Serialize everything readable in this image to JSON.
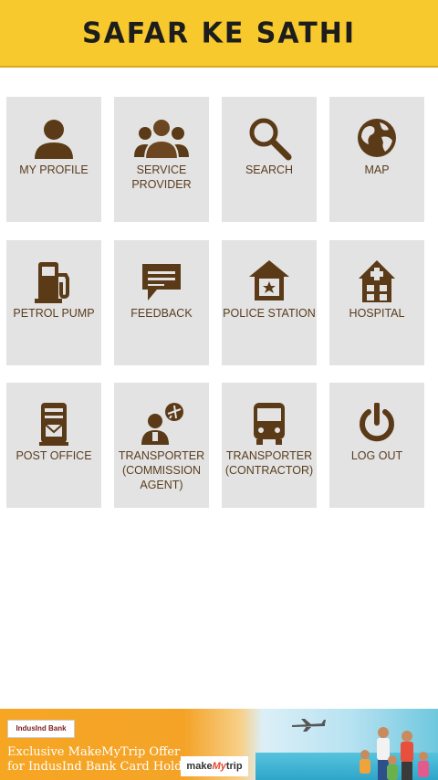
{
  "header": {
    "title": "SAFAR KE SATHI"
  },
  "tiles": [
    {
      "label": "MY PROFILE",
      "icon": "person-icon"
    },
    {
      "label": "SERVICE PROVIDER",
      "icon": "group-icon"
    },
    {
      "label": "SEARCH",
      "icon": "search-icon"
    },
    {
      "label": "MAP",
      "icon": "globe-icon"
    },
    {
      "label": "PETROL PUMP",
      "icon": "fuel-pump-icon"
    },
    {
      "label": "FEEDBACK",
      "icon": "chat-bubble-icon"
    },
    {
      "label": "POLICE STATION",
      "icon": "police-station-icon"
    },
    {
      "label": "HOSPITAL",
      "icon": "hospital-icon"
    },
    {
      "label": "POST OFFICE",
      "icon": "postbox-icon"
    },
    {
      "label": "TRANSPORTER (COMMISSION AGENT)",
      "icon": "agent-icon"
    },
    {
      "label": "TRANSPORTER (CONTRACTOR)",
      "icon": "bus-icon"
    },
    {
      "label": "LOG OUT",
      "icon": "power-icon"
    }
  ],
  "banner": {
    "bank": "IndusInd Bank",
    "offer_line1": "Exclusive MakeMyTrip Offer",
    "offer_line2": "for IndusInd Bank Card Holders",
    "brand_make": "make",
    "brand_my": "My",
    "brand_trip": "trip"
  },
  "colors": {
    "header": "#f8c92c",
    "tile": "#e3e3e3",
    "icon": "#5b3a17"
  }
}
